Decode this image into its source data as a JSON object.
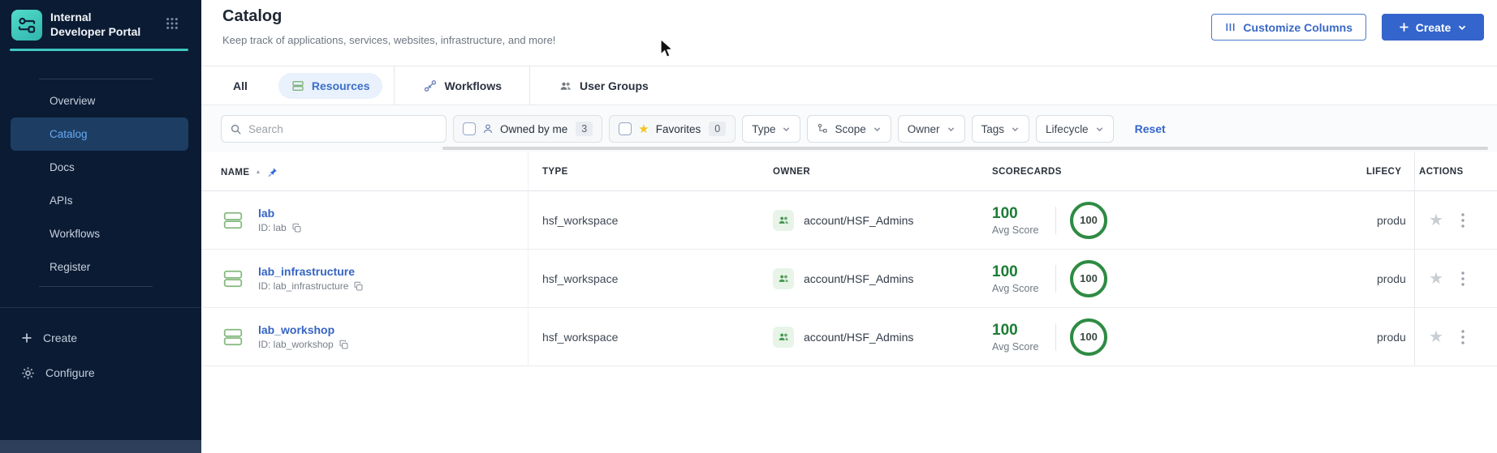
{
  "sidebar": {
    "title": "Internal Developer Portal",
    "items": [
      {
        "label": "Overview"
      },
      {
        "label": "Catalog"
      },
      {
        "label": "Docs"
      },
      {
        "label": "APIs"
      },
      {
        "label": "Workflows"
      },
      {
        "label": "Register"
      }
    ],
    "create_label": "Create",
    "configure_label": "Configure"
  },
  "header": {
    "title": "Catalog",
    "subtitle": "Keep track of applications, services, websites, infrastructure, and more!",
    "customize_columns_label": "Customize Columns",
    "create_label": "Create"
  },
  "tabs": [
    {
      "label": "All"
    },
    {
      "label": "Resources"
    },
    {
      "label": "Workflows"
    },
    {
      "label": "User Groups"
    }
  ],
  "filters": {
    "search_placeholder": "Search",
    "owned_by_me_label": "Owned by me",
    "owned_by_me_count": "3",
    "favorites_label": "Favorites",
    "favorites_count": "0",
    "dropdowns": [
      {
        "label": "Type"
      },
      {
        "label": "Scope"
      },
      {
        "label": "Owner"
      },
      {
        "label": "Tags"
      },
      {
        "label": "Lifecycle"
      }
    ],
    "reset_label": "Reset"
  },
  "table": {
    "columns": {
      "name": "NAME",
      "type": "TYPE",
      "owner": "OWNER",
      "scorecards": "SCORECARDS",
      "lifecycle": "LIFECY",
      "actions": "ACTIONS"
    },
    "rows": [
      {
        "name": "lab",
        "id": "ID: lab",
        "type": "hsf_workspace",
        "owner": "account/HSF_Admins",
        "avg_score": "100",
        "avg_score_label": "Avg Score",
        "score": "100",
        "lifecycle": "produ"
      },
      {
        "name": "lab_infrastructure",
        "id": "ID: lab_infrastructure",
        "type": "hsf_workspace",
        "owner": "account/HSF_Admins",
        "avg_score": "100",
        "avg_score_label": "Avg Score",
        "score": "100",
        "lifecycle": "produ"
      },
      {
        "name": "lab_workshop",
        "id": "ID: lab_workshop",
        "type": "hsf_workspace",
        "owner": "account/HSF_Admins",
        "avg_score": "100",
        "avg_score_label": "Avg Score",
        "score": "100",
        "lifecycle": "produ"
      }
    ]
  },
  "colors": {
    "accent_blue": "#3465cc",
    "teal": "#3dc7c0",
    "score_green": "#1e8a3c",
    "link_blue": "#3564c2",
    "sidebar_bg": "#0b1b33"
  }
}
